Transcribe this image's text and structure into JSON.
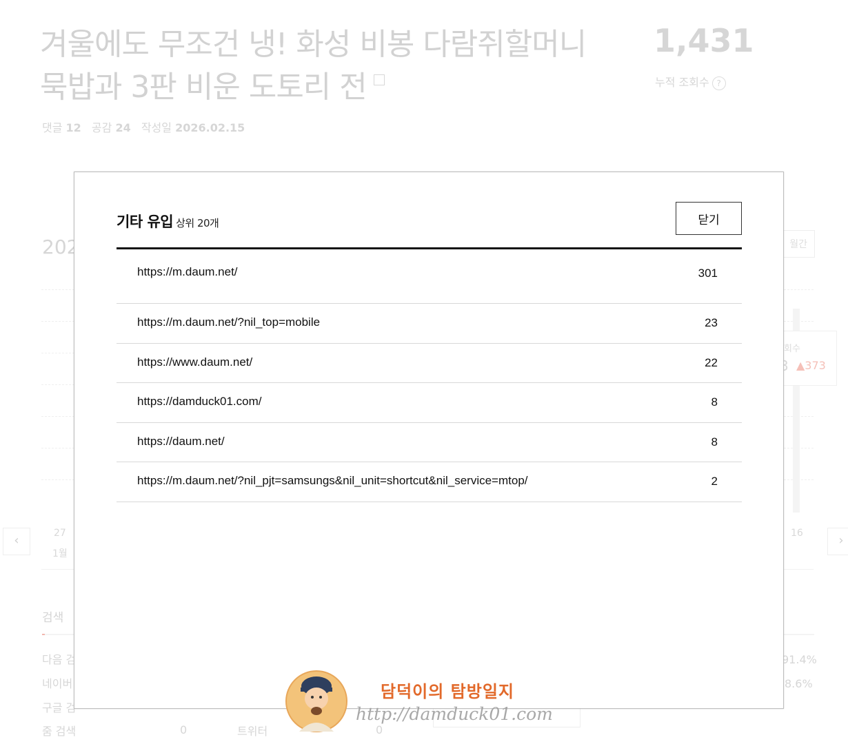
{
  "post": {
    "title_line1": "겨울에도 무조건 냉! 화성 비봉 다람쥐할머니",
    "title_line2": "묵밥과 3판 비운 도토리 전",
    "meta_comments_label": "댓글",
    "meta_comments": "12",
    "meta_likes_label": "공감",
    "meta_likes": "24",
    "meta_date_label": "작성일",
    "meta_date": "2026.02.15",
    "views": "1,431",
    "views_label": "누적 조회수"
  },
  "chart_area": {
    "year_fragment": "202",
    "range_button": "월간",
    "tooltip_label": "회수",
    "tooltip_value": "3",
    "tooltip_delta": "▲373",
    "x_first_day": "27",
    "x_first_month": "1월",
    "x_last_day": "16"
  },
  "search_section": {
    "heading": "검색",
    "rows": [
      "다음 검",
      "네이버",
      "구글 검",
      "줌 검색"
    ],
    "pct_1": "91.4%",
    "pct_2": "8.6%",
    "zero_1": "0",
    "twitter_label": "트위터",
    "zero_2": "0"
  },
  "modal": {
    "title": "기타 유입",
    "subtitle": "상위 20개",
    "close_label": "닫기",
    "referrers": [
      {
        "url": "https://m.daum.net/",
        "count": "301"
      },
      {
        "url": "https://m.daum.net/?nil_top=mobile",
        "count": "23"
      },
      {
        "url": "https://www.daum.net/",
        "count": "22"
      },
      {
        "url": "https://damduck01.com/",
        "count": "8"
      },
      {
        "url": "https://daum.net/",
        "count": "8"
      },
      {
        "url": "https://m.daum.net/?nil_pjt=samsungs&nil_unit=shortcut&nil_service=mtop/",
        "count": "2"
      }
    ]
  },
  "watermark": {
    "title": "담덕이의 탐방일지",
    "url": "http://damduck01.com"
  },
  "colors": {
    "accent_delta": "#f5c0b8",
    "watermark_orange": "#e2692a"
  }
}
